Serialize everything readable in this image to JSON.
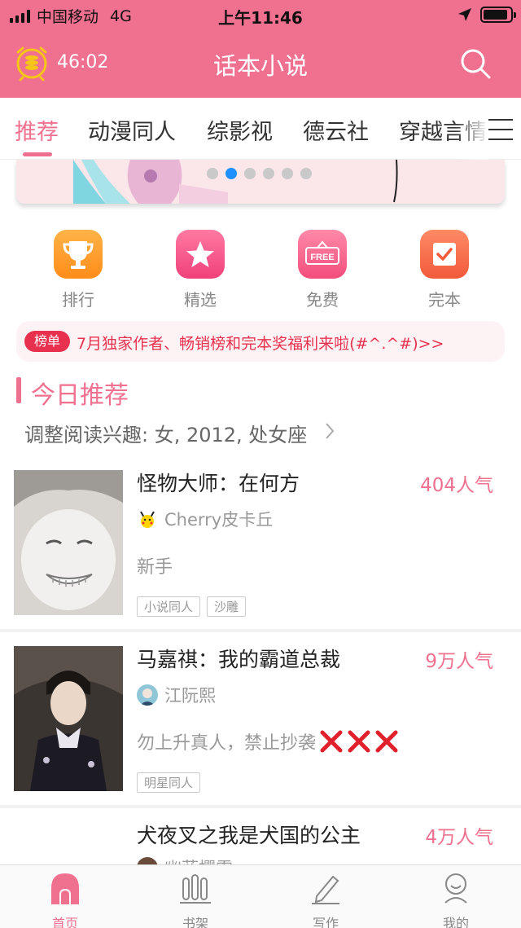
{
  "status_bar": {
    "carrier": "中国移动",
    "network": "4G",
    "time": "上午11:46",
    "battery_level": 0.9
  },
  "header": {
    "timer": "46:02",
    "title": "话本小说",
    "timer_icon": "coin-alarm-icon",
    "search_icon": "search-icon"
  },
  "tabs": {
    "items": [
      {
        "label": "推荐",
        "active": true
      },
      {
        "label": "动漫同人"
      },
      {
        "label": "综影视"
      },
      {
        "label": "德云社"
      },
      {
        "label": "穿越言情"
      }
    ],
    "menu_icon": "menu-icon"
  },
  "banner": {
    "page_count": 6,
    "active_index": 1
  },
  "shortcuts": [
    {
      "label": "排行",
      "icon": "trophy-icon"
    },
    {
      "label": "精选",
      "icon": "star-icon"
    },
    {
      "label": "免费",
      "icon": "free-icon",
      "icon_text": "FREE"
    },
    {
      "label": "完本",
      "icon": "check-icon"
    }
  ],
  "notice": {
    "badge": "榜单",
    "text": "7月独家作者、畅销榜和完本奖福利来啦(#^.^#)>>"
  },
  "section": {
    "title": "今日推荐",
    "interest": "调整阅读兴趣: 女, 2012, 处女座"
  },
  "books": [
    {
      "title": "怪物大师：在何方",
      "popularity": "404人气",
      "author": "Cherry皮卡丘",
      "description": "新手",
      "tags": [
        "小说同人",
        "沙雕"
      ]
    },
    {
      "title": "马嘉祺：我的霸道总裁",
      "popularity": "9万人气",
      "author": "江阮熙",
      "description": "勿上升真人，禁止抄袭",
      "tags": [
        "明星同人"
      ]
    },
    {
      "title": "犬夜叉之我是犬国的公主",
      "popularity": "4万人气",
      "author": "幽蓝樱雪"
    }
  ],
  "bottom_nav": [
    {
      "label": "首页",
      "icon": "home-icon",
      "active": true
    },
    {
      "label": "书架",
      "icon": "bookshelf-icon"
    },
    {
      "label": "写作",
      "icon": "pen-icon"
    },
    {
      "label": "我的",
      "icon": "profile-icon"
    }
  ],
  "colors": {
    "brand": "#f07090",
    "notice_red": "#e8314f",
    "banner_dot_active": "#1e90ff"
  }
}
